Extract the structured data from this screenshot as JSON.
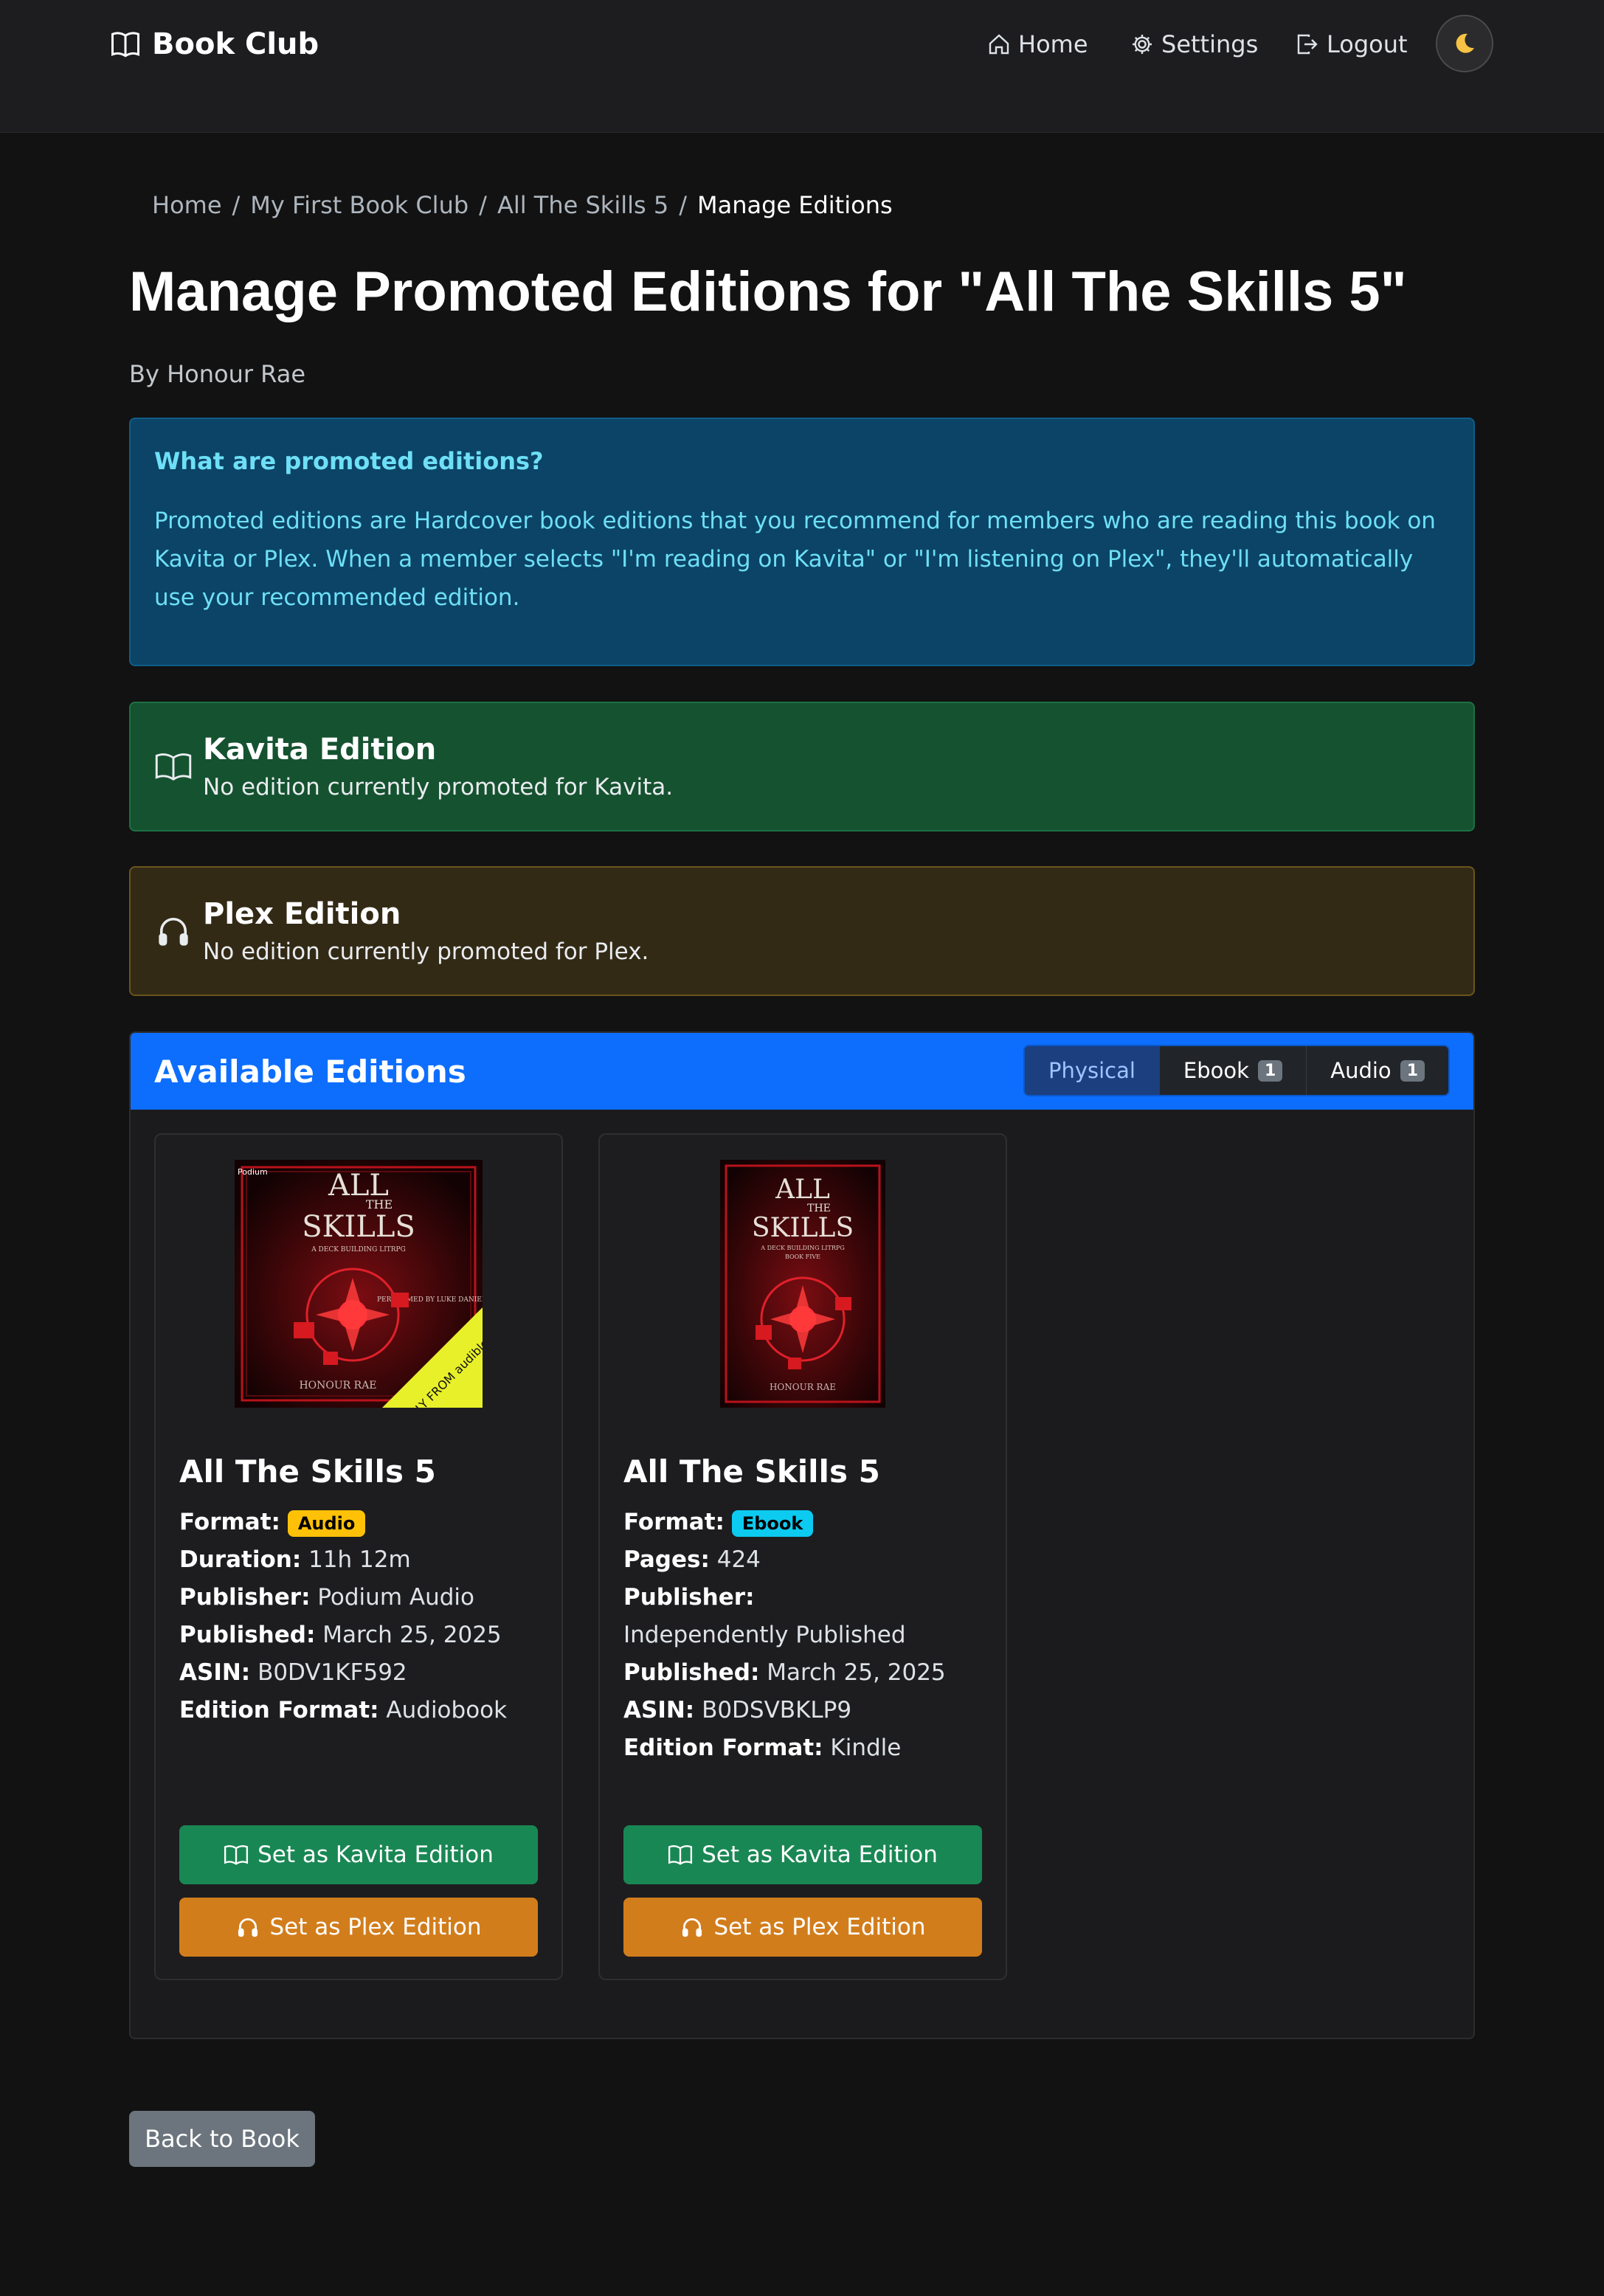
{
  "navbar": {
    "brand": "Book Club",
    "links": {
      "home": "Home",
      "settings": "Settings",
      "logout": "Logout"
    }
  },
  "breadcrumb": {
    "items": [
      "Home",
      "My First Book Club",
      "All The Skills 5"
    ],
    "active": "Manage Editions"
  },
  "page": {
    "title": "Manage Promoted Editions for \"All The Skills 5\"",
    "byline": "By Honour Rae"
  },
  "info": {
    "heading": "What are promoted editions?",
    "body": "Promoted editions are Hardcover book editions that you recommend for members who are reading this book on Kavita or Plex. When a member selects \"I'm reading on Kavita\" or \"I'm listening on Plex\", they'll automatically use your recommended edition."
  },
  "kavita": {
    "heading": "Kavita Edition",
    "text": "No edition currently promoted for Kavita."
  },
  "plex": {
    "heading": "Plex Edition",
    "text": "No edition currently promoted for Plex."
  },
  "editions": {
    "heading": "Available Editions",
    "filters": [
      {
        "label": "Physical",
        "count": "",
        "active": true
      },
      {
        "label": "Ebook",
        "count": "1",
        "active": false
      },
      {
        "label": "Audio",
        "count": "1",
        "active": false
      }
    ],
    "books": [
      {
        "title": "All The Skills 5",
        "format_label": "Format:",
        "format": "Audio",
        "rows": [
          {
            "k": "Duration:",
            "v": "11h 12m"
          },
          {
            "k": "Publisher:",
            "v": "Podium Audio"
          },
          {
            "k": "Published:",
            "v": "March 25, 2025"
          },
          {
            "k": "ASIN:",
            "v": "B0DV1KF592"
          },
          {
            "k": "Edition Format:",
            "v": "Audiobook"
          }
        ],
        "cover": {
          "top": "ALL",
          "mid": "THE",
          "bottom": "SKILLS",
          "tag": "A DECK BUILDING LITRPG",
          "author": "HONOUR RAE",
          "publisher": "Podium",
          "narrator": "PERFORMED BY LUKE DANIELS",
          "ribbon": "ONLY FROM audible"
        },
        "kavita_btn": "Set as Kavita Edition",
        "plex_btn": "Set as Plex Edition"
      },
      {
        "title": "All The Skills 5",
        "format_label": "Format:",
        "format": "Ebook",
        "rows": [
          {
            "k": "Pages:",
            "v": "424"
          },
          {
            "k": "Publisher:",
            "v": "Independently Published"
          },
          {
            "k": "Published:",
            "v": "March 25, 2025"
          },
          {
            "k": "ASIN:",
            "v": "B0DSVBKLP9"
          },
          {
            "k": "Edition Format:",
            "v": "Kindle"
          }
        ],
        "cover": {
          "top": "ALL",
          "mid": "THE",
          "bottom": "SKILLS",
          "tag": "A DECK BUILDING LITRPG",
          "book": "BOOK FIVE",
          "author": "HONOUR RAE"
        },
        "kavita_btn": "Set as Kavita Edition",
        "plex_btn": "Set as Plex Edition"
      }
    ]
  },
  "back_button": "Back to Book",
  "colors": {
    "primary": "#0d6efd",
    "success": "#198754",
    "warning_btn": "#d27d1c",
    "info_bg": "#0b4466",
    "kavita_bg": "#155230",
    "plex_bg": "#332a16"
  }
}
